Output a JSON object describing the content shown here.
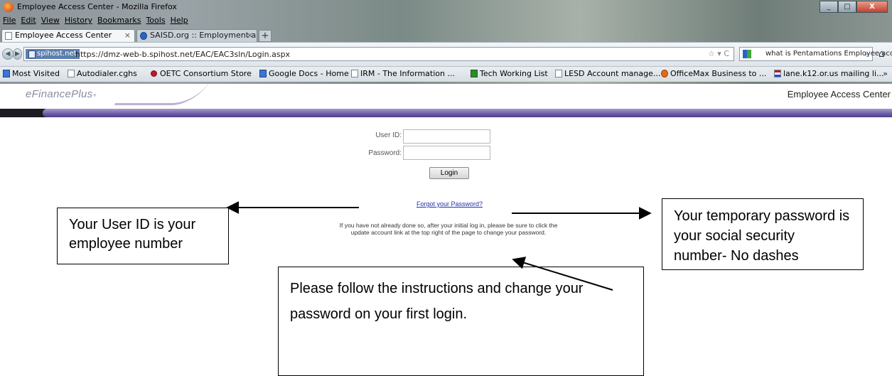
{
  "window": {
    "title": "Employee Access Center - Mozilla Firefox",
    "minimize": "_",
    "maximize": "□",
    "close": "X"
  },
  "menu": [
    "File",
    "Edit",
    "View",
    "History",
    "Bookmarks",
    "Tools",
    "Help"
  ],
  "tabs": [
    {
      "label": "Employee Access Center",
      "close": "×"
    },
    {
      "label": "SAISD.org :: Employment and...",
      "close": "×"
    }
  ],
  "new_tab": "+",
  "nav": {
    "site_badge": "spihost.net",
    "url": "https://dmz-web-b.spihost.net/EAC/EAC3sln/Login.aspx",
    "url_right": "☆ ▾ C",
    "search_value": "what is Pentamations Employee access center"
  },
  "bookmarks": [
    {
      "label": "Most Visited",
      "icon": "gdoc"
    },
    {
      "label": "Autodialer.cghs",
      "icon": "page"
    },
    {
      "label": "OETC Consortium Store",
      "icon": "dot"
    },
    {
      "label": "Google Docs - Home",
      "icon": "gdoc"
    },
    {
      "label": "IRM - The Information ...",
      "icon": "page"
    },
    {
      "label": "Tech Working List",
      "icon": "green"
    },
    {
      "label": "LESD Account manage...",
      "icon": "page"
    },
    {
      "label": "OfficeMax Business to ...",
      "icon": "orange"
    },
    {
      "label": "lane.k12.or.us mailing li...",
      "icon": "flag"
    }
  ],
  "bookmarks_more": "»",
  "page": {
    "brand": "eFinancePlus",
    "brand_mark": "+",
    "header_title": "Employee Access Center",
    "user_id_label": "User ID:",
    "password_label": "Password:",
    "user_id_value": "",
    "password_value": "",
    "login_label": "Login",
    "forgot_link": "Forgot your Password?",
    "notice": "If you have not already done so, after your initial log in, please be sure to click the update account link at the top right of the page to change your password."
  },
  "callouts": {
    "user_id": "Your User ID is your employee number",
    "password": "Your temporary password is your social security number- No dashes",
    "instructions": "Please follow the instructions and change your password on your first login."
  }
}
